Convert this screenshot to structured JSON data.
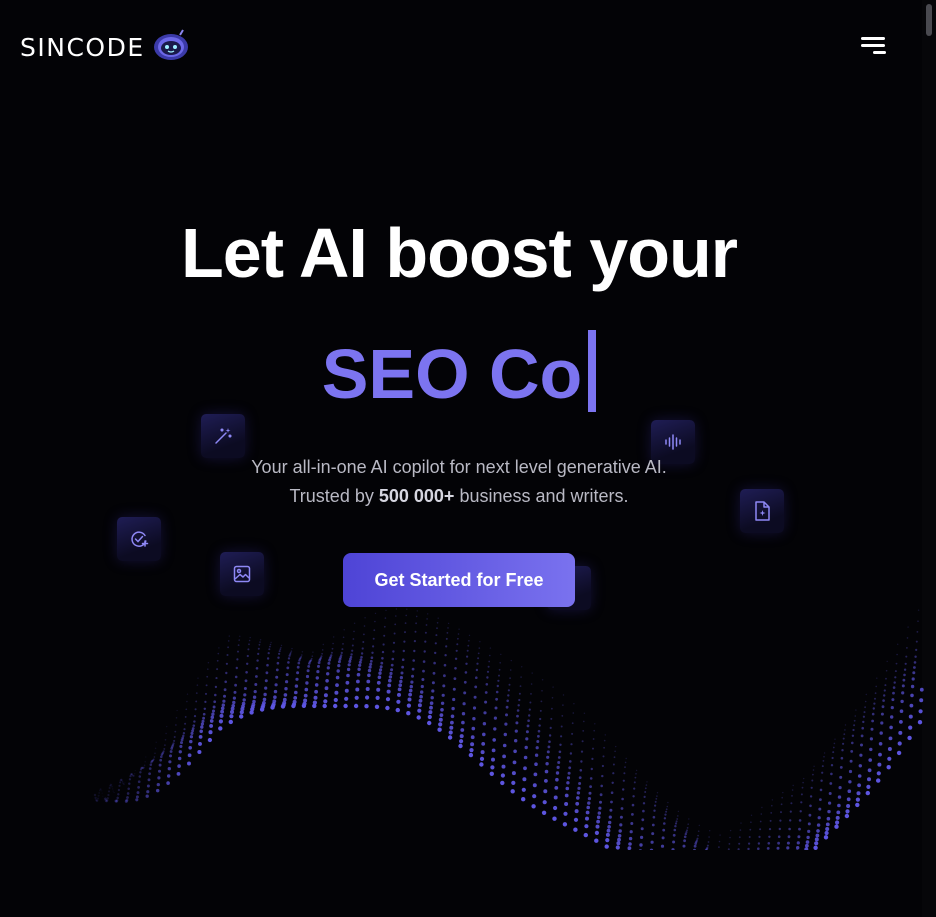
{
  "header": {
    "logo_text": "SINCODE",
    "logo_icon": "robot-icon",
    "menu_icon": "hamburger-menu-icon"
  },
  "hero": {
    "headline": "Let AI boost your",
    "typed_text": "SEO Co",
    "subtitle_line1": "Your all-in-one AI copilot for next level generative AI.",
    "subtitle_prefix": "Trusted by",
    "subtitle_count": "500 000+",
    "subtitle_suffix": "business and writers.",
    "cta_label": "Get Started for Free"
  },
  "floating_icons": [
    "magic-wand-icon",
    "waveform-icon",
    "document-sparkle-icon",
    "check-plus-icon",
    "image-icon",
    "arrow-icon"
  ],
  "colors": {
    "background": "#030306",
    "accent": "#7c74f0",
    "button_start": "#4e44d6",
    "button_end": "#7a72ef",
    "wave_dots": "#5d55e0"
  }
}
